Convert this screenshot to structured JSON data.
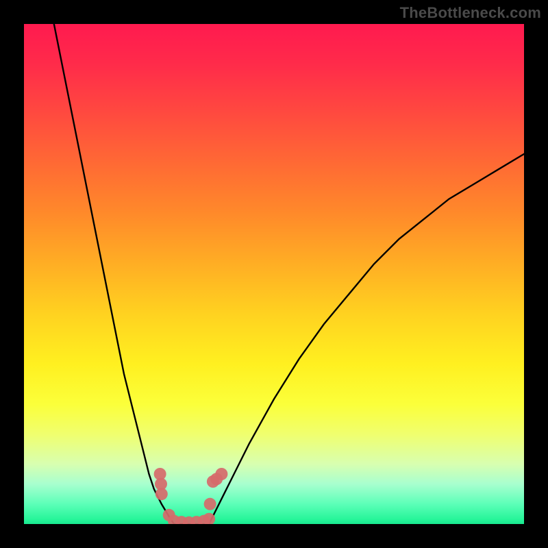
{
  "watermark": "TheBottleneck.com",
  "colors": {
    "background": "#000000",
    "curve": "#000000",
    "marker": "#d66a6a",
    "gradient_stops": [
      "#ff1a4f",
      "#ff2b4a",
      "#ff4a3f",
      "#ff6a34",
      "#ff8a2a",
      "#ffae24",
      "#ffd220",
      "#fff020",
      "#fbff3a",
      "#f0ff6e",
      "#d8ffb0",
      "#a8ffcf",
      "#5cffb8",
      "#28f59a",
      "#18e890"
    ]
  },
  "chart_data": {
    "type": "line",
    "title": "",
    "xlabel": "",
    "ylabel": "",
    "xlim": [
      0,
      100
    ],
    "ylim": [
      0,
      100
    ],
    "note": "Axes are unlabeled in the source image; values are normalized 0–100 estimates read from pixel positions. Two curves descend from the top edge and meet near the bottom around x≈30–37 forming a narrow valley at y≈0.",
    "series": [
      {
        "name": "left-curve",
        "x": [
          6,
          8,
          10,
          12,
          14,
          16,
          18,
          20,
          22,
          24,
          25,
          26,
          27.5,
          29,
          30
        ],
        "y": [
          100,
          90,
          80,
          70,
          60,
          50,
          40,
          30,
          22,
          14,
          10,
          7,
          4,
          1.5,
          0
        ]
      },
      {
        "name": "right-curve",
        "x": [
          37,
          38,
          39,
          40,
          42,
          45,
          50,
          55,
          60,
          65,
          70,
          75,
          80,
          85,
          90,
          95,
          100
        ],
        "y": [
          0,
          2,
          4,
          6,
          10,
          16,
          25,
          33,
          40,
          46,
          52,
          57,
          61,
          65,
          68,
          71,
          74
        ]
      },
      {
        "name": "valley-floor",
        "x": [
          30,
          31,
          32,
          33,
          34,
          35,
          36,
          37
        ],
        "y": [
          0,
          0,
          0,
          0,
          0,
          0,
          0,
          0
        ]
      }
    ],
    "markers": {
      "name": "salmon-dots",
      "note": "Cluster of small salmon-colored circles along the valley walls/floor near x≈27–40, y≈0–10.",
      "points": [
        {
          "x": 27.2,
          "y": 10.0
        },
        {
          "x": 27.4,
          "y": 8.0
        },
        {
          "x": 27.5,
          "y": 6.0
        },
        {
          "x": 29.0,
          "y": 1.8
        },
        {
          "x": 30.0,
          "y": 0.6
        },
        {
          "x": 31.5,
          "y": 0.4
        },
        {
          "x": 33.0,
          "y": 0.3
        },
        {
          "x": 34.5,
          "y": 0.4
        },
        {
          "x": 36.0,
          "y": 0.6
        },
        {
          "x": 37.0,
          "y": 1.0
        },
        {
          "x": 37.2,
          "y": 4.0
        },
        {
          "x": 37.8,
          "y": 8.5
        },
        {
          "x": 38.5,
          "y": 9.0
        },
        {
          "x": 39.5,
          "y": 10.0
        }
      ]
    }
  }
}
